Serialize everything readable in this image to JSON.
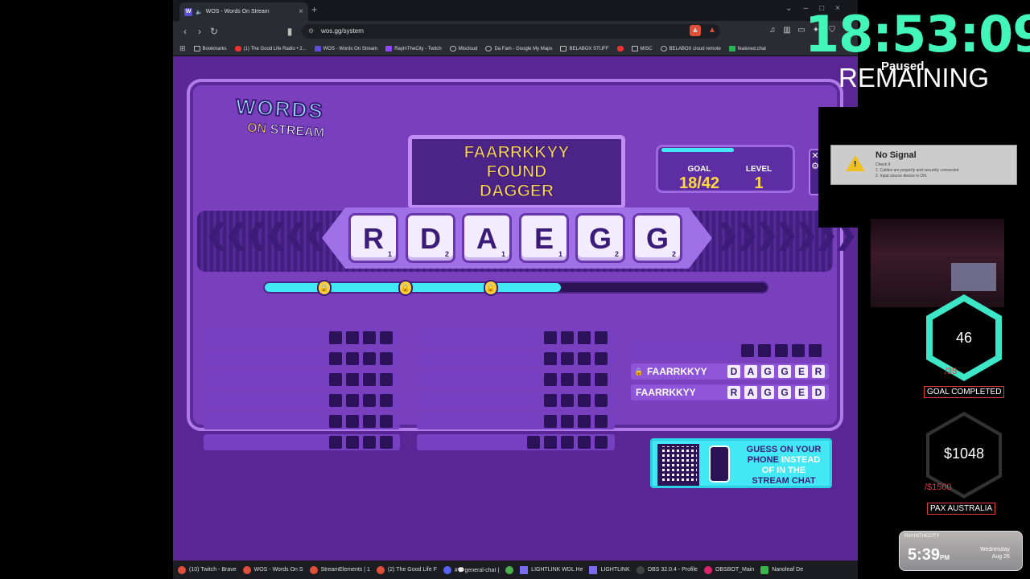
{
  "browser": {
    "tab_title": "WOS - Words On Stream",
    "url": "wos.gg/system",
    "bookmarks": [
      "Bookmarks",
      "(1) The Good Life Radio • 2...",
      "WOS - Words On Stream",
      "RayInTheCity - Twitch",
      "Miscloud",
      "Da Fam - Google My Maps",
      "BELABOX STUFF",
      "MISC",
      "BELABOX cloud remote",
      "featured.chat"
    ]
  },
  "game": {
    "logo_words": "WORDS",
    "logo_on": "ON",
    "logo_stream": "STREAM",
    "banner_lines": [
      "FAARRKKYY",
      "FOUND",
      "DAGGER"
    ],
    "goal_label": "GOAL",
    "goal_value": "18/42",
    "level_label": "LEVEL",
    "level_value": "1",
    "tiles": [
      {
        "letter": "R",
        "points": "1"
      },
      {
        "letter": "D",
        "points": "2"
      },
      {
        "letter": "A",
        "points": "1"
      },
      {
        "letter": "E",
        "points": "1"
      },
      {
        "letter": "G",
        "points": "2"
      },
      {
        "letter": "G",
        "points": "2"
      }
    ],
    "progress": 0.59,
    "found_words": [
      {
        "player": "FAARRKKYY",
        "word": [
          "D",
          "A",
          "G",
          "G",
          "E",
          "R"
        ]
      },
      {
        "player": "FAARRKKYY",
        "word": [
          "R",
          "A",
          "G",
          "G",
          "E",
          "D"
        ]
      }
    ],
    "qr_line1": "GUESS ON YOUR",
    "qr_line2": "PHONE",
    "qr_line3": "INSTEAD",
    "qr_line4": "OF IN THE",
    "qr_line5": "STREAM CHAT"
  },
  "overlay": {
    "timer": "18:53:09",
    "paused": "Paused",
    "remaining": "REMAINING",
    "no_signal_title": "No Signal",
    "no_signal_lines": [
      "Check if",
      "1. Cables are properly and securely connected.",
      "2. Input source device is ON."
    ],
    "hex1_value": "46",
    "hex1_sub": "/35",
    "hex1_badge": "GOAL COMPLETED",
    "hex2_value": "$1048",
    "hex2_sub": "/$1500",
    "hex2_badge": "PAX AUSTRALIA",
    "clock_name": "RAYINTHECITY",
    "clock_time": "5:39",
    "clock_ampm": "PM",
    "clock_day": "Wednesday",
    "clock_date": "Aug 26"
  },
  "taskbar": [
    "(10) Twitch - Brave",
    "WOS - Words On S",
    "StreamElements | 1",
    "(2) The Good Life F",
    "#💬general-chat |",
    "",
    "LIGHTLINK WDL He",
    "LIGHTLINK",
    "OBS 32.0.4 - Profile",
    "OBSBOT_Main",
    "Nanoleaf De"
  ]
}
